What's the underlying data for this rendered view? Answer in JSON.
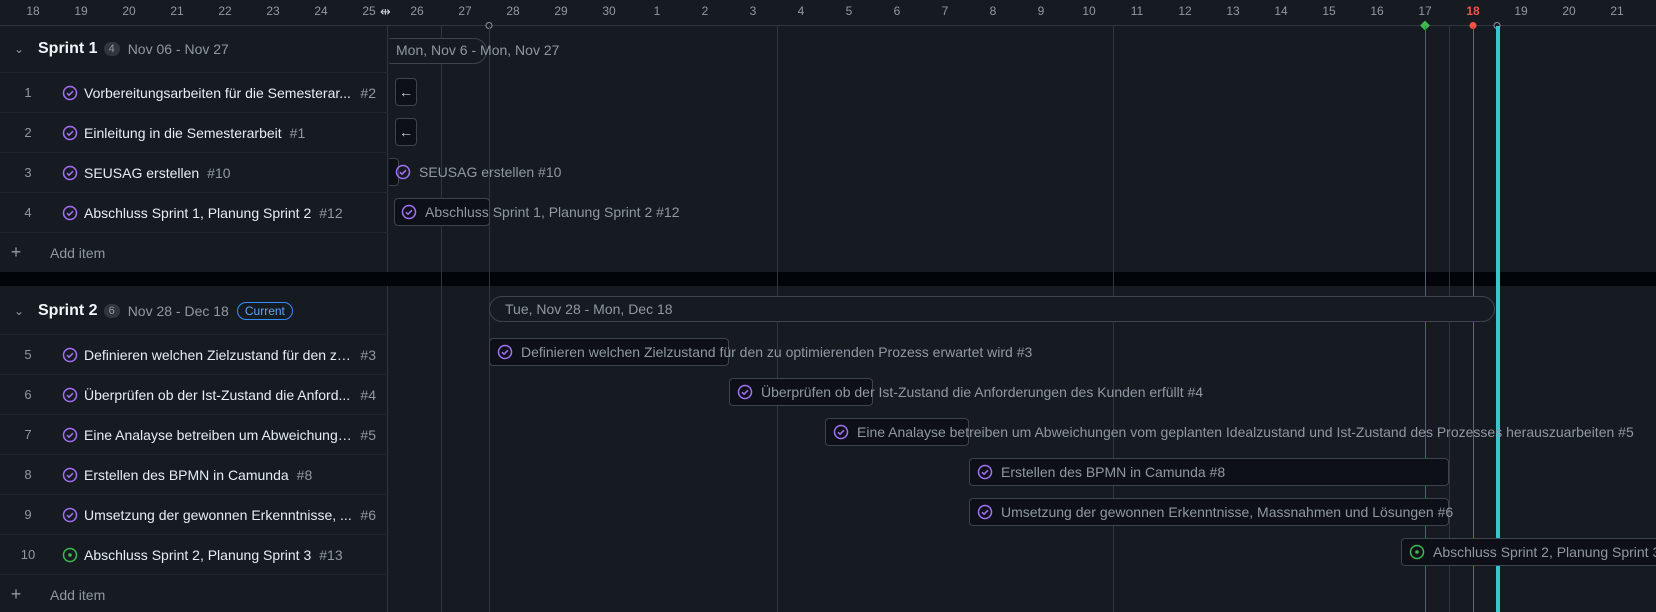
{
  "ruler": {
    "ticks": [
      "18",
      "19",
      "20",
      "21",
      "22",
      "23",
      "24",
      "25",
      "26",
      "27",
      "28",
      "29",
      "30",
      "1",
      "2",
      "3",
      "4",
      "5",
      "6",
      "7",
      "8",
      "9",
      "10",
      "11",
      "12",
      "13",
      "14",
      "15",
      "16",
      "17",
      "18",
      "19",
      "20",
      "21"
    ]
  },
  "groups": [
    {
      "title": "Sprint 1",
      "count": "4",
      "dates": "Nov 06 - Nov 27",
      "pill": "Mon, Nov 6 - Mon, Nov 27",
      "items": [
        {
          "num": "1",
          "title": "Vorbereitungsarbeiten für die Semesterar...",
          "ref": "#2",
          "status": "done"
        },
        {
          "num": "2",
          "title": "Einleitung in die Semesterarbeit",
          "ref": "#1",
          "status": "done"
        },
        {
          "num": "3",
          "title": "SEUSAG erstellen",
          "ref": "#10",
          "status": "done",
          "bar": "SEUSAG erstellen #10"
        },
        {
          "num": "4",
          "title": "Abschluss Sprint 1, Planung Sprint 2",
          "ref": "#12",
          "status": "done",
          "bar": "Abschluss Sprint 1, Planung Sprint 2 #12"
        }
      ],
      "add_label": "Add item"
    },
    {
      "title": "Sprint 2",
      "count": "6",
      "dates": "Nov 28 - Dec 18",
      "badge": "Current",
      "pill": "Tue, Nov 28 - Mon, Dec 18",
      "items": [
        {
          "num": "5",
          "title": "Definieren welchen Zielzustand für den zu...",
          "ref": "#3",
          "status": "done",
          "bar": "Definieren welchen Zielzustand für den zu optimierenden Prozess erwartet wird #3"
        },
        {
          "num": "6",
          "title": "Überprüfen ob der Ist-Zustand die Anford...",
          "ref": "#4",
          "status": "done",
          "bar": "Überprüfen ob der Ist-Zustand die Anforderungen des Kunden erfüllt #4"
        },
        {
          "num": "7",
          "title": "Eine Analayse betreiben um Abweichunge...",
          "ref": "#5",
          "status": "done",
          "bar": "Eine Analayse betreiben um Abweichungen vom geplanten Idealzustand und Ist-Zustand des Prozesses herauszuarbeiten #5"
        },
        {
          "num": "8",
          "title": "Erstellen des BPMN in Camunda",
          "ref": "#8",
          "status": "done",
          "bar": "Erstellen des BPMN in Camunda #8"
        },
        {
          "num": "9",
          "title": "Umsetzung der gewonnen Erkenntnisse, ...",
          "ref": "#6",
          "status": "done",
          "bar": "Umsetzung der gewonnen Erkenntnisse, Massnahmen und Lösungen #6"
        },
        {
          "num": "10",
          "title": "Abschluss Sprint 2, Planung Sprint 3",
          "ref": "#13",
          "status": "open",
          "bar": "Abschluss Sprint 2, Planung Sprint 3"
        }
      ],
      "add_label": "Add item"
    }
  ],
  "colors": {
    "done": "#a371f7",
    "open": "#3fb950",
    "today": "#f85149",
    "today_line": "#39c5cf"
  }
}
